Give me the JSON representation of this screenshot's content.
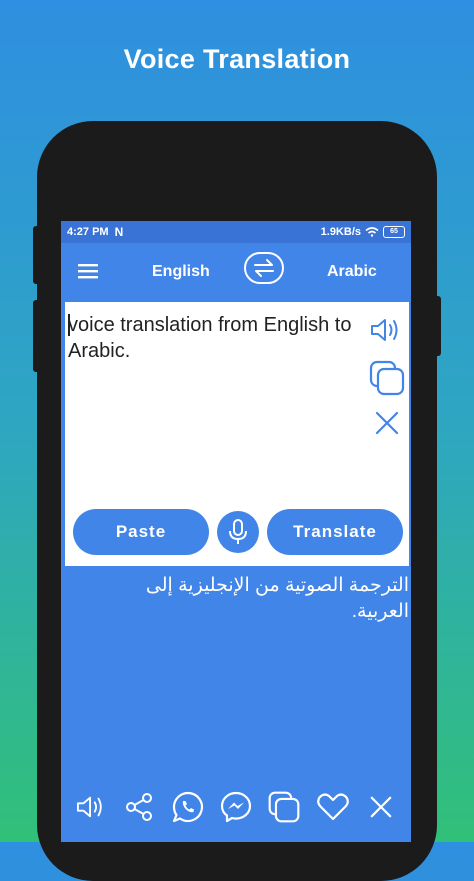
{
  "headline": "Voice Translation",
  "status_bar": {
    "time": "4:27 PM",
    "network_speed": "1.9KB/s",
    "battery": "65"
  },
  "app_bar": {
    "source_language": "English",
    "target_language": "Arabic"
  },
  "input": {
    "text": "voice translation from English to Arabic."
  },
  "buttons": {
    "paste": "Paste",
    "translate": "Translate"
  },
  "output": {
    "text": "الترجمة الصوتية من الإنجليزية إلى العربية."
  },
  "colors": {
    "accent": "#4285e8",
    "status_bar": "#3a73d6",
    "phone_frame": "#1b1b1b"
  },
  "icons": {
    "input_tools": [
      "speaker-icon",
      "copy-icon",
      "close-icon"
    ],
    "bottom_tools": [
      "speaker-icon",
      "share-icon",
      "whatsapp-icon",
      "messenger-icon",
      "copy-icon",
      "heart-icon",
      "close-icon"
    ]
  }
}
